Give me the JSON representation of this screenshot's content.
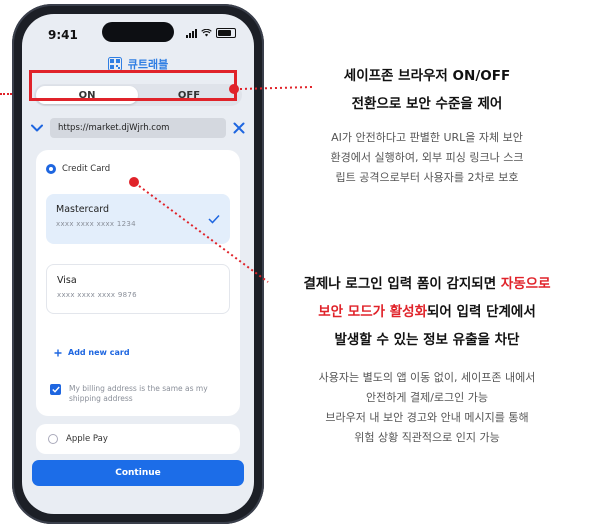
{
  "phone": {
    "time": "9:41",
    "brand": "큐트래블",
    "toggle": {
      "on_label": "ON",
      "off_label": "OFF"
    },
    "url": "https://market.djWjrh.com",
    "payment": {
      "credit_card_label": "Credit Card",
      "cards": [
        {
          "name": "Mastercard",
          "number": "xxxx xxxx xxxx 1234",
          "selected": true
        },
        {
          "name": "Visa",
          "number": "xxxx xxxx xxxx 9876",
          "selected": false
        }
      ],
      "add_new_card": "Add new card",
      "billing_same": "My billing address is the same as my shipping address",
      "apple_pay": "Apple Pay"
    },
    "continue_label": "Continue"
  },
  "annotation1": {
    "title_red": "세이프존 브라우저 ON/OFF",
    "title_black": "전환으로 보안 수준을 제어",
    "body": [
      "AI가 안전하다고 판별한 URL을 자체 보안",
      "환경에서 실행하여, 외부 피싱 링크나 스크",
      "립트 공격으로부터 사용자를 2차로 보호"
    ]
  },
  "annotation2": {
    "line1_black": "결제나 로그인 입력 폼이 감지되면 ",
    "line1_red": "자동으로",
    "line2_red": "보안 모드가 활성화",
    "line2_black": "되어 입력 단계에서",
    "line3_black": "발생할 수 있는 정보 유출을 차단",
    "body": [
      "사용자는 별도의 앱 이동 없이, 세이프존 내에서",
      "안전하게 결제/로그인 가능",
      "브라우저 내 보안 경고와 안내 메시지를 통해",
      "위험 상황 직관적으로 인지 가능"
    ]
  },
  "colors": {
    "accent": "#e0232a",
    "primary": "#1c6de8",
    "brand": "#2f7ee3"
  },
  "icons": [
    "signal-icon",
    "wifi-icon",
    "battery-icon",
    "brand-logo-icon",
    "chevron-down-icon",
    "close-icon",
    "checkmark-icon",
    "plus-icon",
    "checkbox-icon"
  ]
}
